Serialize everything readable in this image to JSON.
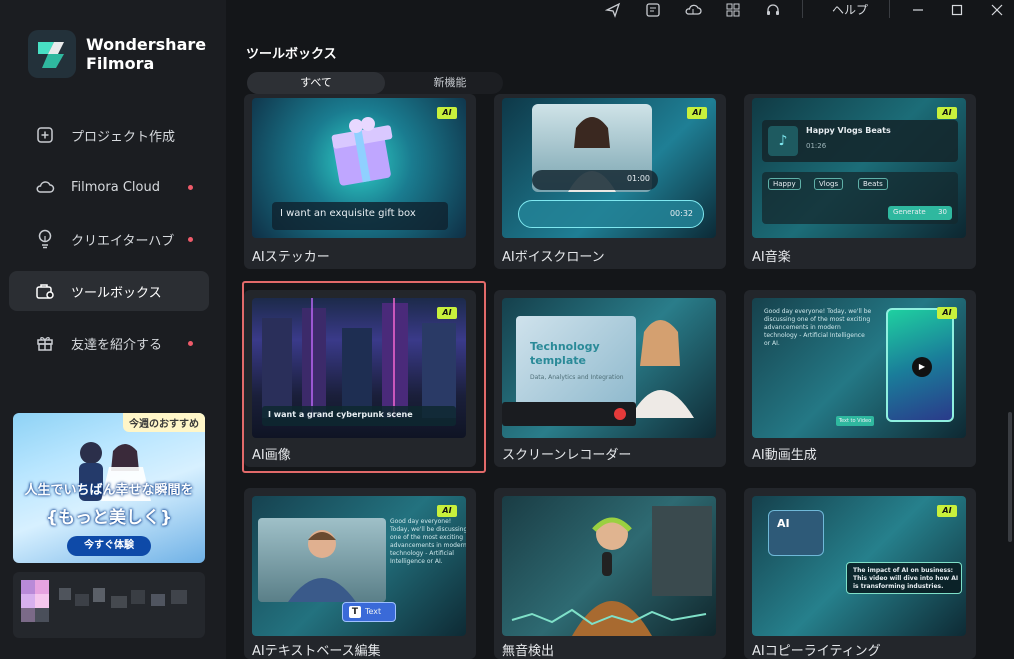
{
  "app": {
    "brand_line1": "Wondershare",
    "brand_line2": "Filmora"
  },
  "sidebar": {
    "items": [
      {
        "label": "プロジェクト作成",
        "icon": "plus-square-icon",
        "active": false,
        "dot": false
      },
      {
        "label": "Filmora Cloud",
        "icon": "cloud-icon",
        "active": false,
        "dot": true
      },
      {
        "label": "クリエイターハブ",
        "icon": "lightbulb-icon",
        "active": false,
        "dot": true
      },
      {
        "label": "ツールボックス",
        "icon": "toolbox-icon",
        "active": true,
        "dot": false
      },
      {
        "label": "友達を紹介する",
        "icon": "gift-icon",
        "active": false,
        "dot": true
      }
    ],
    "promo": {
      "tag": "今週のおすすめ",
      "headline1": "人生でいちばん幸せな瞬間を",
      "headline2": "{もっと美しく}",
      "cta": "今すぐ体験"
    }
  },
  "topbar": {
    "icons": [
      "send-icon",
      "project-icon",
      "cloud-upload-icon",
      "grid-icon",
      "headset-icon"
    ],
    "help_label": "ヘルプ",
    "window_controls": [
      "minimize-icon",
      "maximize-icon",
      "close-icon"
    ]
  },
  "main": {
    "title": "ツールボックス",
    "tabs": [
      {
        "label": "すべて",
        "active": true
      },
      {
        "label": "新機能",
        "active": false
      }
    ],
    "ai_badge": "AI",
    "cards": [
      {
        "label": "AIステッカー",
        "ai": true,
        "thumb_text": "I want an exquisite gift box"
      },
      {
        "label": "AIボイスクローン",
        "ai": true,
        "thumb_time1": "01:00",
        "thumb_time2": "00:32"
      },
      {
        "label": "AI音楽",
        "ai": true,
        "thumb_title": "Happy Vlogs Beats",
        "thumb_time": "01:26",
        "tags": [
          "Happy",
          "Vlogs",
          "Beats"
        ],
        "generate": "Generate",
        "credits": "30"
      },
      {
        "label": "AI画像",
        "ai": true,
        "selected": true,
        "thumb_text": "I want a grand cyberpunk scene"
      },
      {
        "label": "スクリーンレコーダー",
        "ai": false,
        "thumb_title1": "Technology",
        "thumb_title2": "template",
        "thumb_sub": "Data, Analytics and Integration"
      },
      {
        "label": "AI動画生成",
        "ai": true,
        "thumb_para": "Good day everyone! Today, we'll be discussing one of the most exciting advancements in modern technology - Artificial Intelligence or AI.",
        "thumb_btn": "Text to Video"
      },
      {
        "label": "AIテキストベース編集",
        "ai": true,
        "thumb_para": "Good day everyone! Today, we'll be discussing one of the most exciting advancements in modern technology - Artificial Intelligence or AI.",
        "thumb_chip": "Text"
      },
      {
        "label": "無音検出",
        "ai": false
      },
      {
        "label": "AIコピーライティング",
        "ai": true,
        "thumb_para": "The impact of AI on business: This video will dive into how AI is transforming industries.",
        "thumb_logo": "AI"
      }
    ]
  },
  "colors": {
    "accent_ai": "#c8f03c",
    "selection": "#e26a6a",
    "notification_dot": "#ef5b6a"
  }
}
